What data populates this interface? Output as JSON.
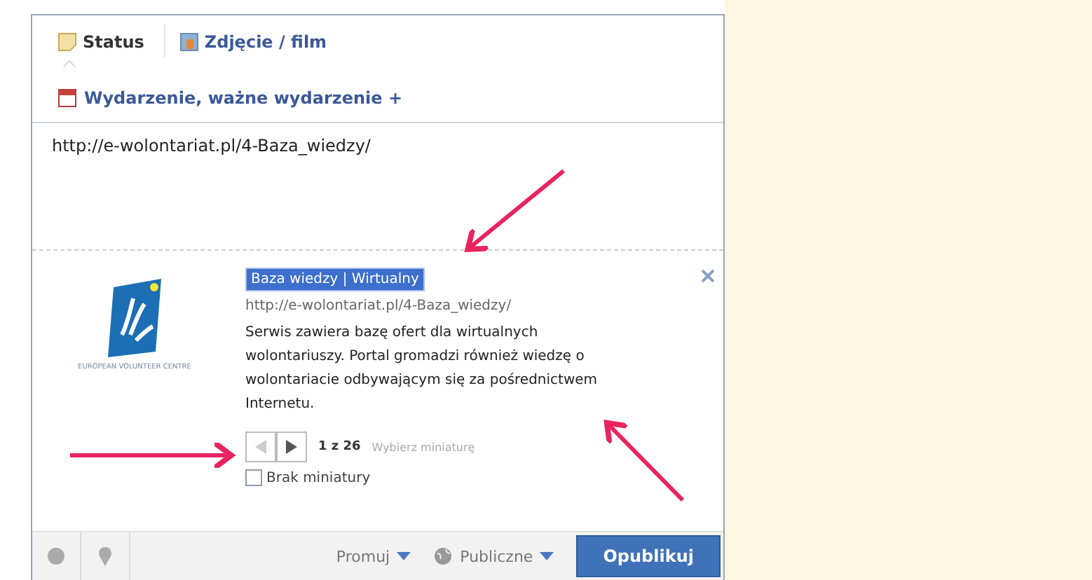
{
  "tabs": [
    {
      "label": "Status",
      "kind": "status",
      "selected": true
    },
    {
      "label": "Zdjęcie / film",
      "kind": "photo",
      "selected": false
    }
  ],
  "event_link": "Wydarzenie, ważne wydarzenie +",
  "composer": {
    "value": "http://e-wolontariat.pl/4-Baza_wiedzy/"
  },
  "preview": {
    "logo_caption": "EUROPEAN VOLUNTEER CENTRE",
    "title": "Baza wiedzy | Wirtualny",
    "title_selected": true,
    "url": "http://e-wolontariat.pl/4-Baza_wiedzy/",
    "description": "Serwis zawiera bazę ofert dla wirtualnych wolontariuszy. Portal gromadzi również wiedzę o wolontariacie odbywającym się za pośrednictwem Internetu.",
    "pager_buttons": [
      {
        "kind": "prev",
        "disabled": true
      },
      {
        "kind": "next",
        "disabled": false
      }
    ],
    "pager_count": "1 z 26",
    "choose_thumbnail": "Wybierz miniaturę",
    "no_thumbnail": {
      "label": "Brak miniatury",
      "checked": false
    }
  },
  "footer": {
    "promote": "Promuj",
    "audience": "Publiczne",
    "publish": "Opublikuj"
  }
}
